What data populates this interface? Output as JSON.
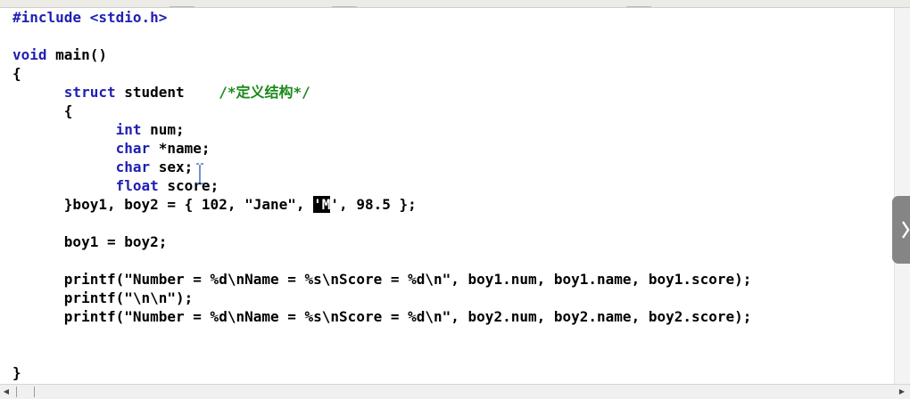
{
  "editor": {
    "lines": [
      [
        {
          "t": "#include <stdio.h>",
          "c": "kw"
        }
      ],
      [],
      [
        {
          "t": "void",
          "c": "kw"
        },
        {
          "t": " main()"
        }
      ],
      [
        {
          "t": "{"
        }
      ],
      [
        {
          "t": "      "
        },
        {
          "t": "struct",
          "c": "kw"
        },
        {
          "t": " student    "
        },
        {
          "t": "/*定义结构*/",
          "c": "cm"
        }
      ],
      [
        {
          "t": "      {"
        }
      ],
      [
        {
          "t": "            "
        },
        {
          "t": "int",
          "c": "kw"
        },
        {
          "t": " num;"
        }
      ],
      [
        {
          "t": "            "
        },
        {
          "t": "char",
          "c": "kw"
        },
        {
          "t": " *name;"
        }
      ],
      [
        {
          "t": "            "
        },
        {
          "t": "char",
          "c": "kw"
        },
        {
          "t": " sex;"
        }
      ],
      [
        {
          "t": "            "
        },
        {
          "t": "float",
          "c": "kw"
        },
        {
          "t": " score;"
        }
      ],
      [
        {
          "t": "      }boy1, boy2 = { 102, \"Jane\", "
        },
        {
          "t": "'M",
          "c": "sel"
        },
        {
          "t": "', 98.5 };"
        }
      ],
      [],
      [
        {
          "t": "      boy1 = boy2;"
        }
      ],
      [],
      [
        {
          "t": "      printf(\"Number = %d\\nName = %s\\nScore = %d\\n\", boy1.num, boy1.name, boy1.score);"
        }
      ],
      [
        {
          "t": "      printf(\"\\n\\n\");"
        }
      ],
      [
        {
          "t": "      printf(\"Number = %d\\nName = %s\\nScore = %d\\n\", boy2.num, boy2.name, boy2.score);"
        }
      ],
      [],
      [],
      [
        {
          "t": "}"
        }
      ]
    ]
  },
  "icons": {
    "side_handle": "chevron-right-icon",
    "scroll_left": "scroll-left-arrow-icon",
    "scroll_right": "scroll-right-arrow-icon",
    "cursor": "text-cursor-icon"
  },
  "colors": {
    "keyword": "#1f1fb5",
    "comment": "#1a8a1a",
    "text": "#000000",
    "selection": "#000000"
  }
}
